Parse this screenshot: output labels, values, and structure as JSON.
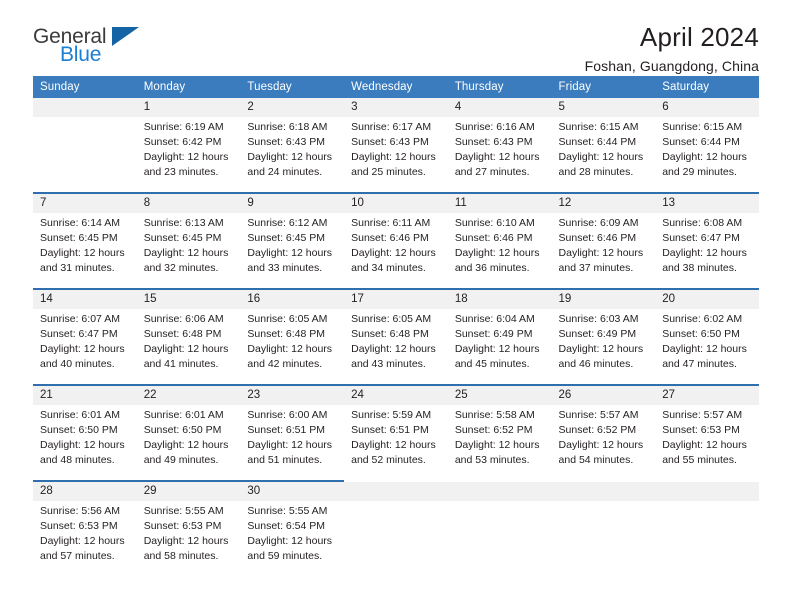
{
  "brand": {
    "name_part1": "General",
    "name_part2": "Blue"
  },
  "header": {
    "title": "April 2024",
    "location": "Foshan, Guangdong, China"
  },
  "colors": {
    "header_blue": "#3a7cbe",
    "rule_blue": "#2f6fad",
    "daynum_band": "#f1f1f1",
    "brand_blue": "#1b7fd4",
    "text": "#231f20"
  },
  "weekday_headers": [
    "Sunday",
    "Monday",
    "Tuesday",
    "Wednesday",
    "Thursday",
    "Friday",
    "Saturday"
  ],
  "labels": {
    "sunrise_prefix": "Sunrise: ",
    "sunset_prefix": "Sunset: ",
    "daylight_prefix": "Daylight: "
  },
  "weeks": [
    {
      "days": [
        {
          "day": "",
          "sunrise": "",
          "sunset": "",
          "daylight_line1": "",
          "daylight_line2": ""
        },
        {
          "day": "1",
          "sunrise": "Sunrise: 6:19 AM",
          "sunset": "Sunset: 6:42 PM",
          "daylight_line1": "Daylight: 12 hours",
          "daylight_line2": "and 23 minutes."
        },
        {
          "day": "2",
          "sunrise": "Sunrise: 6:18 AM",
          "sunset": "Sunset: 6:43 PM",
          "daylight_line1": "Daylight: 12 hours",
          "daylight_line2": "and 24 minutes."
        },
        {
          "day": "3",
          "sunrise": "Sunrise: 6:17 AM",
          "sunset": "Sunset: 6:43 PM",
          "daylight_line1": "Daylight: 12 hours",
          "daylight_line2": "and 25 minutes."
        },
        {
          "day": "4",
          "sunrise": "Sunrise: 6:16 AM",
          "sunset": "Sunset: 6:43 PM",
          "daylight_line1": "Daylight: 12 hours",
          "daylight_line2": "and 27 minutes."
        },
        {
          "day": "5",
          "sunrise": "Sunrise: 6:15 AM",
          "sunset": "Sunset: 6:44 PM",
          "daylight_line1": "Daylight: 12 hours",
          "daylight_line2": "and 28 minutes."
        },
        {
          "day": "6",
          "sunrise": "Sunrise: 6:15 AM",
          "sunset": "Sunset: 6:44 PM",
          "daylight_line1": "Daylight: 12 hours",
          "daylight_line2": "and 29 minutes."
        }
      ]
    },
    {
      "days": [
        {
          "day": "7",
          "sunrise": "Sunrise: 6:14 AM",
          "sunset": "Sunset: 6:45 PM",
          "daylight_line1": "Daylight: 12 hours",
          "daylight_line2": "and 31 minutes."
        },
        {
          "day": "8",
          "sunrise": "Sunrise: 6:13 AM",
          "sunset": "Sunset: 6:45 PM",
          "daylight_line1": "Daylight: 12 hours",
          "daylight_line2": "and 32 minutes."
        },
        {
          "day": "9",
          "sunrise": "Sunrise: 6:12 AM",
          "sunset": "Sunset: 6:45 PM",
          "daylight_line1": "Daylight: 12 hours",
          "daylight_line2": "and 33 minutes."
        },
        {
          "day": "10",
          "sunrise": "Sunrise: 6:11 AM",
          "sunset": "Sunset: 6:46 PM",
          "daylight_line1": "Daylight: 12 hours",
          "daylight_line2": "and 34 minutes."
        },
        {
          "day": "11",
          "sunrise": "Sunrise: 6:10 AM",
          "sunset": "Sunset: 6:46 PM",
          "daylight_line1": "Daylight: 12 hours",
          "daylight_line2": "and 36 minutes."
        },
        {
          "day": "12",
          "sunrise": "Sunrise: 6:09 AM",
          "sunset": "Sunset: 6:46 PM",
          "daylight_line1": "Daylight: 12 hours",
          "daylight_line2": "and 37 minutes."
        },
        {
          "day": "13",
          "sunrise": "Sunrise: 6:08 AM",
          "sunset": "Sunset: 6:47 PM",
          "daylight_line1": "Daylight: 12 hours",
          "daylight_line2": "and 38 minutes."
        }
      ]
    },
    {
      "days": [
        {
          "day": "14",
          "sunrise": "Sunrise: 6:07 AM",
          "sunset": "Sunset: 6:47 PM",
          "daylight_line1": "Daylight: 12 hours",
          "daylight_line2": "and 40 minutes."
        },
        {
          "day": "15",
          "sunrise": "Sunrise: 6:06 AM",
          "sunset": "Sunset: 6:48 PM",
          "daylight_line1": "Daylight: 12 hours",
          "daylight_line2": "and 41 minutes."
        },
        {
          "day": "16",
          "sunrise": "Sunrise: 6:05 AM",
          "sunset": "Sunset: 6:48 PM",
          "daylight_line1": "Daylight: 12 hours",
          "daylight_line2": "and 42 minutes."
        },
        {
          "day": "17",
          "sunrise": "Sunrise: 6:05 AM",
          "sunset": "Sunset: 6:48 PM",
          "daylight_line1": "Daylight: 12 hours",
          "daylight_line2": "and 43 minutes."
        },
        {
          "day": "18",
          "sunrise": "Sunrise: 6:04 AM",
          "sunset": "Sunset: 6:49 PM",
          "daylight_line1": "Daylight: 12 hours",
          "daylight_line2": "and 45 minutes."
        },
        {
          "day": "19",
          "sunrise": "Sunrise: 6:03 AM",
          "sunset": "Sunset: 6:49 PM",
          "daylight_line1": "Daylight: 12 hours",
          "daylight_line2": "and 46 minutes."
        },
        {
          "day": "20",
          "sunrise": "Sunrise: 6:02 AM",
          "sunset": "Sunset: 6:50 PM",
          "daylight_line1": "Daylight: 12 hours",
          "daylight_line2": "and 47 minutes."
        }
      ]
    },
    {
      "days": [
        {
          "day": "21",
          "sunrise": "Sunrise: 6:01 AM",
          "sunset": "Sunset: 6:50 PM",
          "daylight_line1": "Daylight: 12 hours",
          "daylight_line2": "and 48 minutes."
        },
        {
          "day": "22",
          "sunrise": "Sunrise: 6:01 AM",
          "sunset": "Sunset: 6:50 PM",
          "daylight_line1": "Daylight: 12 hours",
          "daylight_line2": "and 49 minutes."
        },
        {
          "day": "23",
          "sunrise": "Sunrise: 6:00 AM",
          "sunset": "Sunset: 6:51 PM",
          "daylight_line1": "Daylight: 12 hours",
          "daylight_line2": "and 51 minutes."
        },
        {
          "day": "24",
          "sunrise": "Sunrise: 5:59 AM",
          "sunset": "Sunset: 6:51 PM",
          "daylight_line1": "Daylight: 12 hours",
          "daylight_line2": "and 52 minutes."
        },
        {
          "day": "25",
          "sunrise": "Sunrise: 5:58 AM",
          "sunset": "Sunset: 6:52 PM",
          "daylight_line1": "Daylight: 12 hours",
          "daylight_line2": "and 53 minutes."
        },
        {
          "day": "26",
          "sunrise": "Sunrise: 5:57 AM",
          "sunset": "Sunset: 6:52 PM",
          "daylight_line1": "Daylight: 12 hours",
          "daylight_line2": "and 54 minutes."
        },
        {
          "day": "27",
          "sunrise": "Sunrise: 5:57 AM",
          "sunset": "Sunset: 6:53 PM",
          "daylight_line1": "Daylight: 12 hours",
          "daylight_line2": "and 55 minutes."
        }
      ]
    },
    {
      "days": [
        {
          "day": "28",
          "sunrise": "Sunrise: 5:56 AM",
          "sunset": "Sunset: 6:53 PM",
          "daylight_line1": "Daylight: 12 hours",
          "daylight_line2": "and 57 minutes."
        },
        {
          "day": "29",
          "sunrise": "Sunrise: 5:55 AM",
          "sunset": "Sunset: 6:53 PM",
          "daylight_line1": "Daylight: 12 hours",
          "daylight_line2": "and 58 minutes."
        },
        {
          "day": "30",
          "sunrise": "Sunrise: 5:55 AM",
          "sunset": "Sunset: 6:54 PM",
          "daylight_line1": "Daylight: 12 hours",
          "daylight_line2": "and 59 minutes."
        },
        {
          "day": "",
          "sunrise": "",
          "sunset": "",
          "daylight_line1": "",
          "daylight_line2": ""
        },
        {
          "day": "",
          "sunrise": "",
          "sunset": "",
          "daylight_line1": "",
          "daylight_line2": ""
        },
        {
          "day": "",
          "sunrise": "",
          "sunset": "",
          "daylight_line1": "",
          "daylight_line2": ""
        },
        {
          "day": "",
          "sunrise": "",
          "sunset": "",
          "daylight_line1": "",
          "daylight_line2": ""
        }
      ]
    }
  ]
}
